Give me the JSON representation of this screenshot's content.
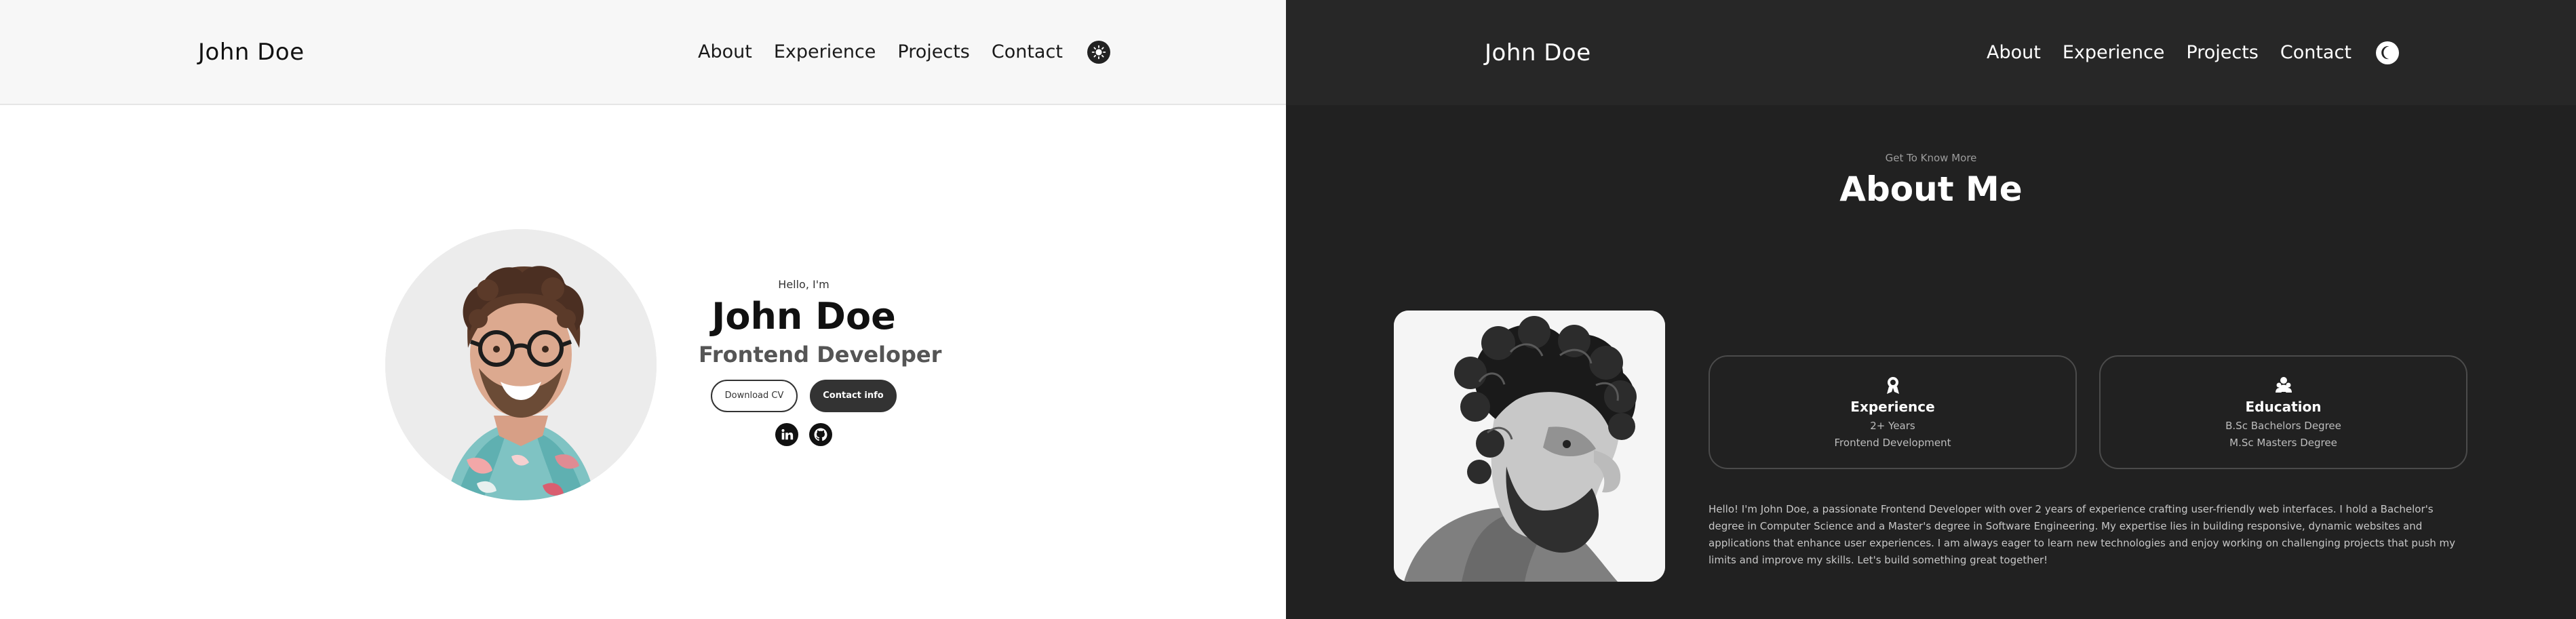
{
  "light": {
    "logo": "John Doe",
    "nav": {
      "links": [
        "About",
        "Experience",
        "Projects",
        "Contact"
      ]
    },
    "hero": {
      "greeting": "Hello, I'm",
      "name": "John Doe",
      "role": "Frontend Developer",
      "buttons": {
        "download": "Download CV",
        "contact": "Contact info"
      }
    }
  },
  "dark": {
    "logo": "John Doe",
    "nav": {
      "links": [
        "About",
        "Experience",
        "Projects",
        "Contact"
      ]
    },
    "about": {
      "kicker": "Get To Know More",
      "title": "About Me",
      "experience": {
        "title": "Experience",
        "line1": "2+ Years",
        "line2": "Frontend Development"
      },
      "education": {
        "title": "Education",
        "line1": "B.Sc Bachelors Degree",
        "line2": "M.Sc Masters Degree"
      },
      "paragraph": "Hello! I'm John Doe, a passionate Frontend Developer with over 2 years of experience crafting user-friendly web interfaces. I hold a Bachelor's degree in Computer Science and a Master's degree in Software Engineering. My expertise lies in building responsive, dynamic websites and applications that enhance user experiences. I am always eager to learn new technologies and enjoy working on challenging projects that push my limits and improve my skills. Let's build something great together!"
    }
  },
  "icons": {
    "light_theme_toggle": "sun-icon",
    "dark_theme_toggle": "moon-icon",
    "linkedin": "linkedin-icon",
    "github": "github-icon",
    "experience": "award-icon",
    "education": "education-icon"
  },
  "colors": {
    "light_background": "#ffffff",
    "light_nav_background": "#f7f7f7",
    "dark_background": "#212121",
    "dark_nav_background": "#272727",
    "button_dark": "#333333",
    "card_border": "#4b4b4b"
  }
}
